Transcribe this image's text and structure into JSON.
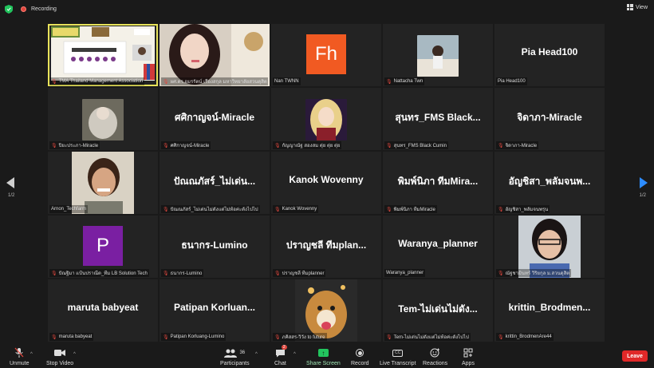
{
  "topbar": {
    "recording_label": "Recording",
    "view_label": "View"
  },
  "pagination": {
    "left": "1/2",
    "right": "1/2"
  },
  "tiles": [
    {
      "label": "TMA Thailand Management Association",
      "type": "screen"
    },
    {
      "label": "ผศ.ดร.อมรรัตน์ เรืองสกุล มหาวิทยาลัยสวนดุสิต",
      "type": "photo"
    },
    {
      "label": "Nan TWNN",
      "type": "avatar",
      "initials": "Fh",
      "color": "#f15a22"
    },
    {
      "label": "Nattacha Twn",
      "type": "photo"
    },
    {
      "label": "Pia Head100",
      "type": "name",
      "big": "Pia Head100"
    },
    {
      "label": "ปิยะประภา-Miracle",
      "type": "photo"
    },
    {
      "label": "ศศิกาญจน์-Miracle",
      "type": "name",
      "big": "ศศิกาญจน์-Miracle"
    },
    {
      "label": "กัญญาณัฐ สองสม ตุ่ย ตุ่ย ตุ่ย",
      "type": "photo"
    },
    {
      "label": "สุนทร_FMS Black Cumin",
      "type": "name",
      "big": "สุนทร_FMS Black..."
    },
    {
      "label": "จิดาภา-Miracle",
      "type": "name",
      "big": "จิดาภา-Miracle"
    },
    {
      "label": "Arnon_Techfarm",
      "type": "photo"
    },
    {
      "label": "ปัณณภัสร์_ไม่เด่นไม่ดังแต่ไม่ท้อค่ะตังไปไป",
      "type": "name",
      "big": "ปัณณภัสร์_ไม่เด่น..."
    },
    {
      "label": "Kanok Wovenny",
      "type": "name",
      "big": "Kanok Wovenny"
    },
    {
      "label": "พิมพ์นิภา ทีมMiracle",
      "type": "name",
      "big": "พิมพ์นิภา ทีมMira..."
    },
    {
      "label": "อัญชิสา_พลัมจนพรุน",
      "type": "name",
      "big": "อัญชิสา_พลัมจนพ..."
    },
    {
      "label": "ปัณฐิมา แป้นปราณีต_ทีม LB Solution Tech",
      "type": "avatar",
      "initials": "P",
      "color": "#7a1fa2"
    },
    {
      "label": "ธนากร-Lumino",
      "type": "name",
      "big": "ธนากร-Lumino"
    },
    {
      "label": "ปราญชลี ทีมplanner",
      "type": "name",
      "big": "ปราญชลี ทีมplan..."
    },
    {
      "label": "Waranya_planner",
      "type": "name",
      "big": "Waranya_planner"
    },
    {
      "label": "ณัฐชามินทร์ วิริยกุล ม.สวนดุสิต",
      "type": "photo"
    },
    {
      "label": "maruta babyeat",
      "type": "name",
      "big": "maruta babyeat"
    },
    {
      "label": "Patipan Korluang-Lumino",
      "type": "name",
      "big": "Patipan Korluan..."
    },
    {
      "label": "ภคิสสร-วิวัง to future",
      "type": "photo"
    },
    {
      "label": "Tem-ไม่เด่นไม่ดังแต่ไม่ท้อค่ะตังไปไป",
      "type": "name",
      "big": "Tem-ไม่เด่นไม่ดัง..."
    },
    {
      "label": "krittin_BrodmenAre44",
      "type": "name",
      "big": "krittin_Brodmen..."
    }
  ],
  "toolbar": {
    "unmute": "Unmute",
    "stop_video": "Stop Video",
    "participants": "Participants",
    "participants_count": "36",
    "chat": "Chat",
    "chat_badge": "2",
    "share_screen": "Share Screen",
    "record": "Record",
    "live_transcript": "Live Transcript",
    "reactions": "Reactions",
    "apps": "Apps",
    "leave": "Leave"
  },
  "colors": {
    "accent_blue": "#2d8cff",
    "share_green": "#22c55e",
    "leave_red": "#e02828",
    "active_outline": "#e8e35a"
  }
}
